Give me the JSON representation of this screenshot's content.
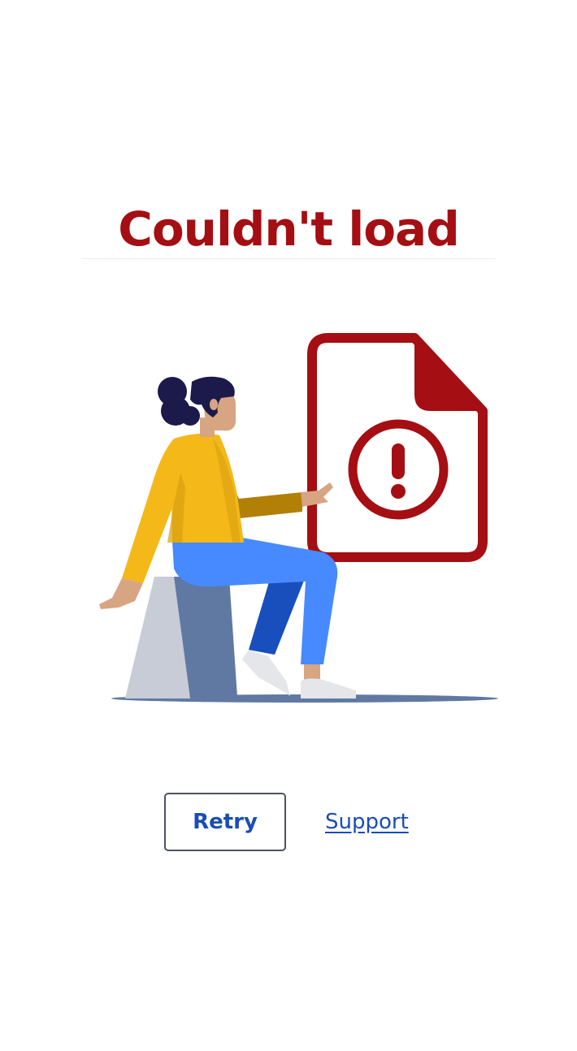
{
  "error": {
    "title": "Couldn't load"
  },
  "illustration": {
    "icon": "document-error-icon",
    "person": "seated-person-illustration",
    "colors": {
      "accent_red": "#a50e12",
      "hair": "#1b1a4a",
      "skin": "#d7a582",
      "sweater": "#f4b819",
      "sweater_shadow": "#b27f07",
      "pants": "#478aff",
      "pants_shadow": "#184fbd",
      "block_light": "#c8ccd6",
      "block_dark": "#6079a3",
      "shadow": "#6079a3",
      "shoes": "#e4e6ea"
    }
  },
  "actions": {
    "retry_label": "Retry",
    "support_label": "Support"
  }
}
